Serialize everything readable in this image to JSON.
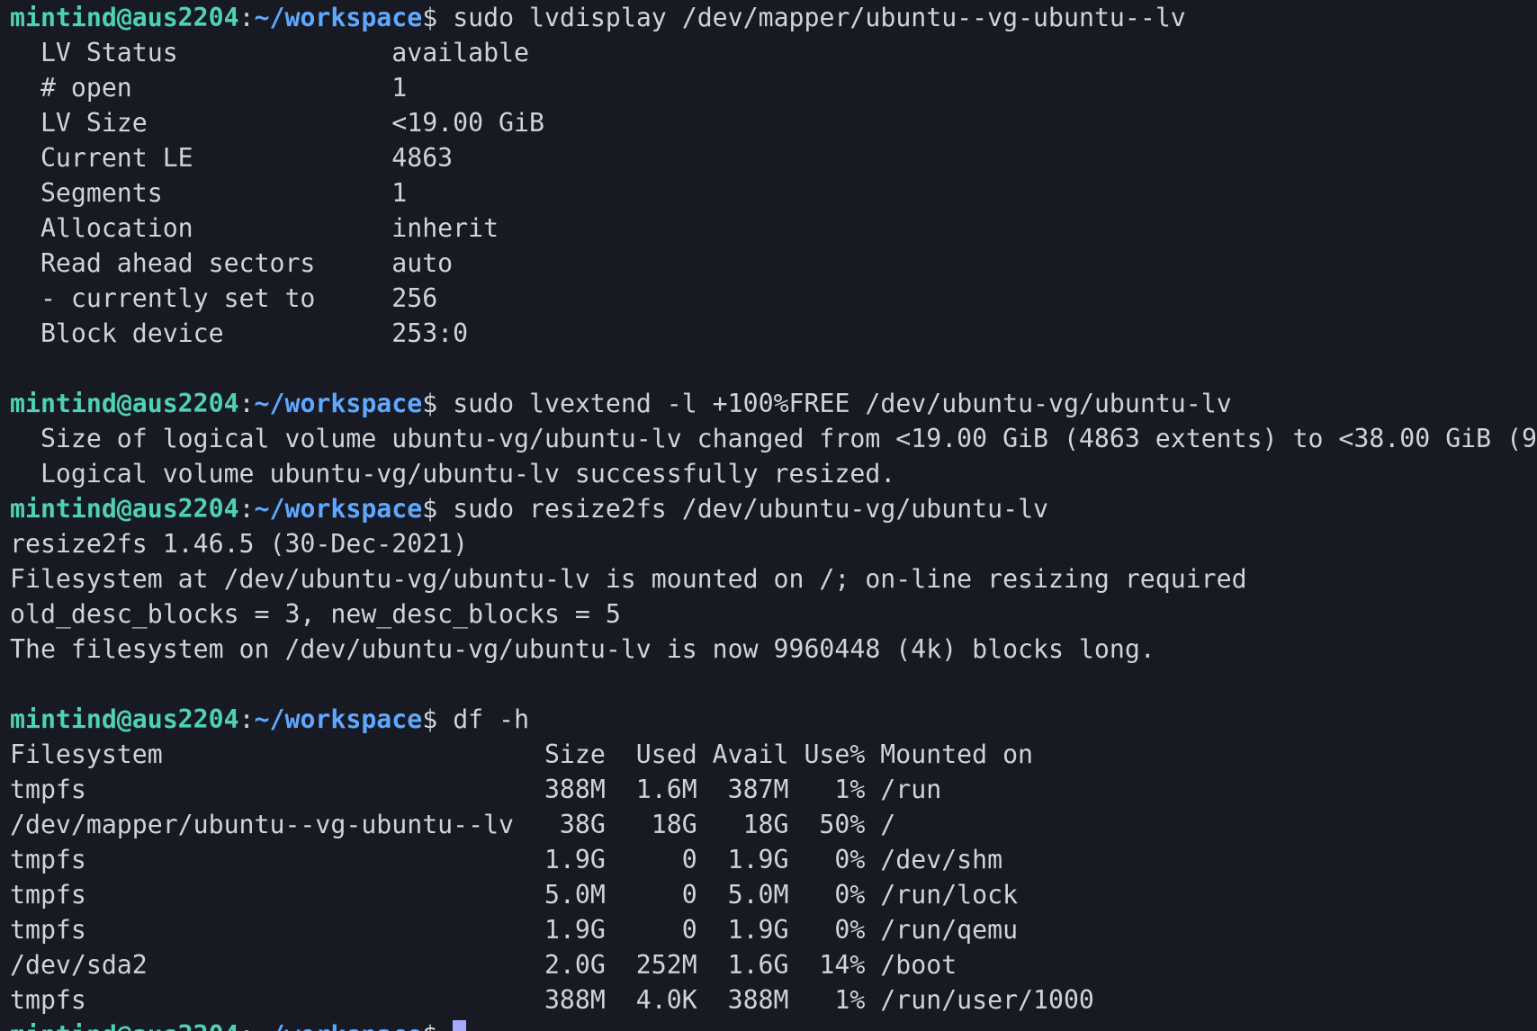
{
  "terminal": {
    "colors": {
      "background": "#171a23",
      "foreground": "#d0d3da",
      "prompt_user": "#4fd1b4",
      "prompt_path": "#5fa8ff",
      "cursor": "#a7a9ff"
    },
    "prompt": {
      "user_host": "mintind@aus2204",
      "separator": ":",
      "path": "~/workspace",
      "symbol": "$"
    },
    "session1": {
      "command": " sudo lvdisplay /dev/mapper/ubuntu--vg-ubuntu--lv",
      "output": [
        "  LV Status              available",
        "  # open                 1",
        "  LV Size                <19.00 GiB",
        "  Current LE             4863",
        "  Segments               1",
        "  Allocation             inherit",
        "  Read ahead sectors     auto",
        "  - currently set to     256",
        "  Block device           253:0",
        ""
      ]
    },
    "session2": {
      "command": " sudo lvextend -l +100%FREE /dev/ubuntu-vg/ubuntu-lv",
      "output": [
        "  Size of logical volume ubuntu-vg/ubuntu-lv changed from <19.00 GiB (4863 extents) to <38.00 GiB (9",
        "  Logical volume ubuntu-vg/ubuntu-lv successfully resized."
      ]
    },
    "session3": {
      "command": " sudo resize2fs /dev/ubuntu-vg/ubuntu-lv",
      "output": [
        "resize2fs 1.46.5 (30-Dec-2021)",
        "Filesystem at /dev/ubuntu-vg/ubuntu-lv is mounted on /; on-line resizing required",
        "old_desc_blocks = 3, new_desc_blocks = 5",
        "The filesystem on /dev/ubuntu-vg/ubuntu-lv is now 9960448 (4k) blocks long.",
        ""
      ]
    },
    "session4": {
      "command": " df -h",
      "output": [
        "Filesystem                         Size  Used Avail Use% Mounted on",
        "tmpfs                              388M  1.6M  387M   1% /run",
        "/dev/mapper/ubuntu--vg-ubuntu--lv   38G   18G   18G  50% /",
        "tmpfs                              1.9G     0  1.9G   0% /dev/shm",
        "tmpfs                              5.0M     0  5.0M   0% /run/lock",
        "tmpfs                              1.9G     0  1.9G   0% /run/qemu",
        "/dev/sda2                          2.0G  252M  1.6G  14% /boot",
        "tmpfs                              388M  4.0K  388M   1% /run/user/1000"
      ]
    }
  }
}
